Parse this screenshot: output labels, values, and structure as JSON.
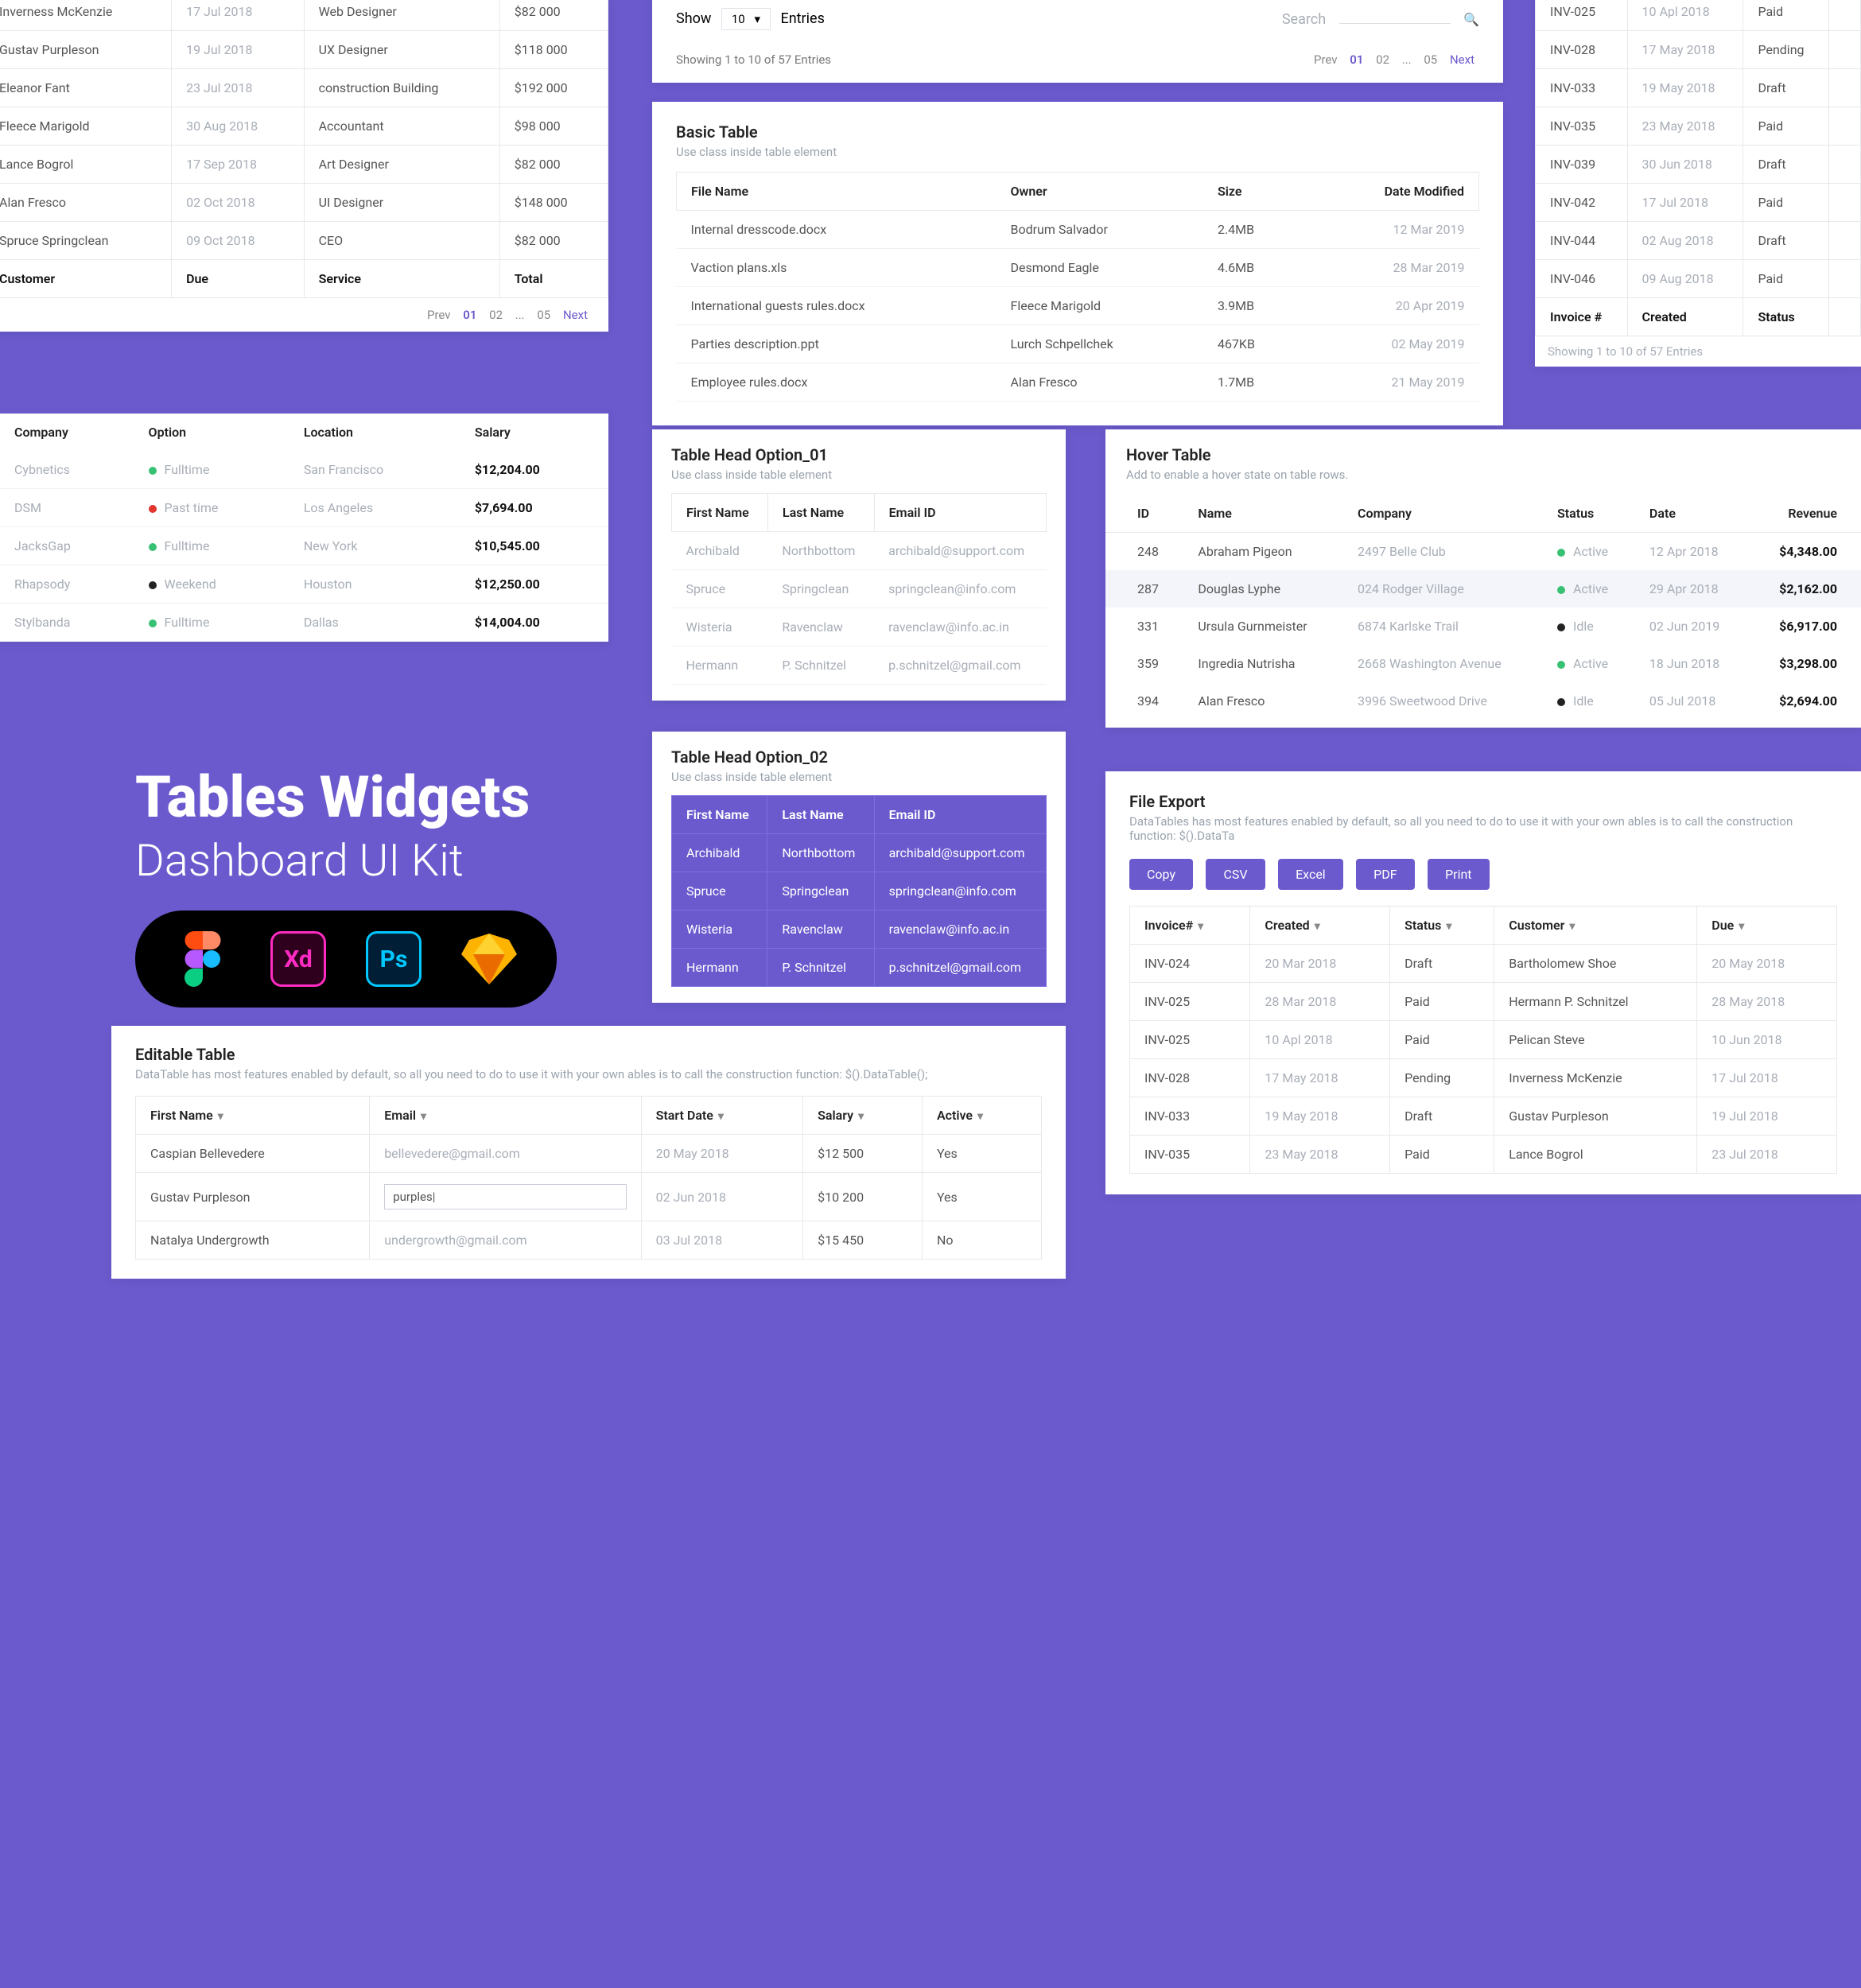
{
  "promo": {
    "title": "Tables Widgets",
    "subtitle": "Dashboard UI Kit"
  },
  "topLeft": {
    "rows": [
      {
        "name": "Inverness McKenzie",
        "date": "17 Jul 2018",
        "role": "Web Designer",
        "amount": "$82 000"
      },
      {
        "name": "Gustav Purpleson",
        "date": "19 Jul 2018",
        "role": "UX Designer",
        "amount": "$118 000"
      },
      {
        "name": "Eleanor Fant",
        "date": "23 Jul 2018",
        "role": "construction Building",
        "amount": "$192 000"
      },
      {
        "name": "Fleece Marigold",
        "date": "30 Aug 2018",
        "role": "Accountant",
        "amount": "$98 000"
      },
      {
        "name": "Lance Bogrol",
        "date": "17 Sep 2018",
        "role": "Art Designer",
        "amount": "$82 000"
      },
      {
        "name": "Alan Fresco",
        "date": "02 Oct 2018",
        "role": "UI Designer",
        "amount": "$148 000"
      },
      {
        "name": "Spruce Springclean",
        "date": "09 Oct 2018",
        "role": "CEO",
        "amount": "$82 000"
      }
    ],
    "footer": {
      "c1": "Customer",
      "c2": "Due",
      "c3": "Service",
      "c4": "Total"
    },
    "pagi": {
      "prev": "Prev",
      "p1": "01",
      "p2": "02",
      "dots": "...",
      "p5": "05",
      "next": "Next"
    }
  },
  "entriesBar": {
    "show": "Show",
    "value": "10",
    "entries": "Entries",
    "search": "Search",
    "showing": "Showing 1 to 10 of 57 Entries",
    "pagi": {
      "prev": "Prev",
      "p1": "01",
      "p2": "02",
      "dots": "...",
      "p5": "05",
      "next": "Next"
    }
  },
  "basic": {
    "title": "Basic Table",
    "sub": "Use class inside table element",
    "headers": {
      "file": "File Name",
      "owner": "Owner",
      "size": "Size",
      "date": "Date Modified"
    },
    "rows": [
      {
        "file": "Internal dresscode.docx",
        "owner": "Bodrum Salvador",
        "size": "2.4MB",
        "date": "12 Mar 2019"
      },
      {
        "file": "Vaction plans.xls",
        "owner": "Desmond Eagle",
        "size": "4.6MB",
        "date": "28 Mar 2019"
      },
      {
        "file": "International guests rules.docx",
        "owner": "Fleece Marigold",
        "size": "3.9MB",
        "date": "20 Apr 2019"
      },
      {
        "file": "Parties description.ppt",
        "owner": "Lurch Schpellchek",
        "size": "467KB",
        "date": "02 May 2019"
      },
      {
        "file": "Employee rules.docx",
        "owner": "Alan Fresco",
        "size": "1.7MB",
        "date": "21 May 2019"
      }
    ]
  },
  "company": {
    "headers": {
      "company": "Company",
      "option": "Option",
      "location": "Location",
      "salary": "Salary"
    },
    "rows": [
      {
        "company": "Cybnetics",
        "opt": "Fulltime",
        "dot": "green",
        "loc": "San Francisco",
        "salary": "$12,204.00"
      },
      {
        "company": "DSM",
        "opt": "Past time",
        "dot": "red",
        "loc": "Los Angeles",
        "salary": "$7,694.00"
      },
      {
        "company": "JacksGap",
        "opt": "Fulltime",
        "dot": "green",
        "loc": "New York",
        "salary": "$10,545.00"
      },
      {
        "company": "Rhapsody",
        "opt": "Weekend",
        "dot": "black",
        "loc": "Houston",
        "salary": "$12,250.00"
      },
      {
        "company": "Stylbanda",
        "opt": "Fulltime",
        "dot": "green",
        "loc": "Dallas",
        "salary": "$14,004.00"
      }
    ]
  },
  "headOpt1": {
    "title": "Table Head Option_01",
    "sub": "Use class inside table element",
    "headers": {
      "fn": "First Name",
      "ln": "Last Name",
      "email": "Email ID"
    },
    "rows": [
      {
        "fn": "Archibald",
        "ln": "Northbottom",
        "email": "archibald@support.com"
      },
      {
        "fn": "Spruce",
        "ln": "Springclean",
        "email": "springclean@info.com"
      },
      {
        "fn": "Wisteria",
        "ln": "Ravenclaw",
        "email": "ravenclaw@info.ac.in"
      },
      {
        "fn": "Hermann",
        "ln": "P. Schnitzel",
        "email": "p.schnitzel@gmail.com"
      }
    ]
  },
  "headOpt2": {
    "title": "Table Head Option_02",
    "sub": "Use class inside table element",
    "headers": {
      "fn": "First Name",
      "ln": "Last Name",
      "email": "Email ID"
    },
    "rows": [
      {
        "fn": "Archibald",
        "ln": "Northbottom",
        "email": "archibald@support.com"
      },
      {
        "fn": "Spruce",
        "ln": "Springclean",
        "email": "springclean@info.com"
      },
      {
        "fn": "Wisteria",
        "ln": "Ravenclaw",
        "email": "ravenclaw@info.ac.in"
      },
      {
        "fn": "Hermann",
        "ln": "P. Schnitzel",
        "email": "p.schnitzel@gmail.com"
      }
    ]
  },
  "hover": {
    "title": "Hover Table",
    "sub": "Add to enable a hover state on table rows.",
    "headers": {
      "id": "ID",
      "name": "Name",
      "company": "Company",
      "status": "Status",
      "date": "Date",
      "revenue": "Revenue"
    },
    "rows": [
      {
        "id": "248",
        "name": "Abraham Pigeon",
        "company": "2497 Belle Club",
        "status": "Active",
        "dot": "green",
        "date": "12 Apr 2018",
        "rev": "$4,348.00"
      },
      {
        "id": "287",
        "name": "Douglas Lyphe",
        "company": "024 Rodger Village",
        "status": "Active",
        "dot": "green",
        "date": "29 Apr 2018",
        "rev": "$2,162.00",
        "alt": true
      },
      {
        "id": "331",
        "name": "Ursula Gurnmeister",
        "company": "6874 Karlske Trail",
        "status": "Idle",
        "dot": "black",
        "date": "02 Jun 2019",
        "rev": "$6,917.00"
      },
      {
        "id": "359",
        "name": "Ingredia Nutrisha",
        "company": "2668 Washington Avenue",
        "status": "Active",
        "dot": "green",
        "date": "18 Jun 2018",
        "rev": "$3,298.00"
      },
      {
        "id": "394",
        "name": "Alan Fresco",
        "company": "3996 Sweetwood Drive",
        "status": "Idle",
        "dot": "black",
        "date": "05 Jul 2018",
        "rev": "$2,694.00"
      }
    ]
  },
  "invoices": {
    "rows": [
      {
        "inv": "INV-025",
        "date": "10 Apl 2018",
        "status": "Paid"
      },
      {
        "inv": "INV-028",
        "date": "17 May 2018",
        "status": "Pending"
      },
      {
        "inv": "INV-033",
        "date": "19 May 2018",
        "status": "Draft"
      },
      {
        "inv": "INV-035",
        "date": "23 May 2018",
        "status": "Paid"
      },
      {
        "inv": "INV-039",
        "date": "30 Jun 2018",
        "status": "Draft"
      },
      {
        "inv": "INV-042",
        "date": "17 Jul 2018",
        "status": "Paid"
      },
      {
        "inv": "INV-044",
        "date": "02 Aug 2018",
        "status": "Draft"
      },
      {
        "inv": "INV-046",
        "date": "09 Aug 2018",
        "status": "Paid"
      }
    ],
    "footer": {
      "inv": "Invoice #",
      "created": "Created",
      "status": "Status"
    },
    "showing": "Showing 1 to 10 of 57 Entries"
  },
  "fileExport": {
    "title": "File Export",
    "sub": "DataTables has most features enabled by default, so all you need to do to use it with your own ables is to call the construction function: $().DataTa",
    "buttons": {
      "copy": "Copy",
      "csv": "CSV",
      "excel": "Excel",
      "pdf": "PDF",
      "print": "Print"
    },
    "headers": {
      "inv": "Invoice#",
      "created": "Created",
      "status": "Status",
      "customer": "Customer",
      "due": "Due"
    },
    "rows": [
      {
        "inv": "INV-024",
        "created": "20 Mar 2018",
        "status": "Draft",
        "customer": "Bartholomew Shoe",
        "due": "20 May 2018"
      },
      {
        "inv": "INV-025",
        "created": "28 Mar 2018",
        "status": "Paid",
        "customer": "Hermann P. Schnitzel",
        "due": "28 May 2018"
      },
      {
        "inv": "INV-025",
        "created": "10 Apl 2018",
        "status": "Paid",
        "customer": "Pelican Steve",
        "due": "10 Jun 2018"
      },
      {
        "inv": "INV-028",
        "created": "17 May 2018",
        "status": "Pending",
        "customer": "Inverness McKenzie",
        "due": "17 Jul 2018"
      },
      {
        "inv": "INV-033",
        "created": "19 May 2018",
        "status": "Draft",
        "customer": "Gustav Purpleson",
        "due": "19 Jul 2018"
      },
      {
        "inv": "INV-035",
        "created": "23 May 2018",
        "status": "Paid",
        "customer": "Lance Bogrol",
        "due": "23 Jul 2018"
      }
    ]
  },
  "editable": {
    "title": "Editable Table",
    "sub": "DataTable has most features enabled by default, so all you need to do to use it with your own ables is to call the construction function: $().DataTable();",
    "headers": {
      "fn": "First Name",
      "email": "Email",
      "start": "Start Date",
      "salary": "Salary",
      "active": "Active"
    },
    "rows": [
      {
        "fn": "Caspian Bellevedere",
        "email": "bellevedere@gmail.com",
        "start": "20 May 2018",
        "salary": "$12 500",
        "active": "Yes"
      },
      {
        "fn": "Gustav Purpleson",
        "email": "purples|",
        "start": "02 Jun 2018",
        "salary": "$10 200",
        "active": "Yes",
        "editing": true
      },
      {
        "fn": "Natalya Undergrowth",
        "email": "undergrowth@gmail.com",
        "start": "03 Jul 2018",
        "salary": "$15 450",
        "active": "No"
      }
    ]
  }
}
